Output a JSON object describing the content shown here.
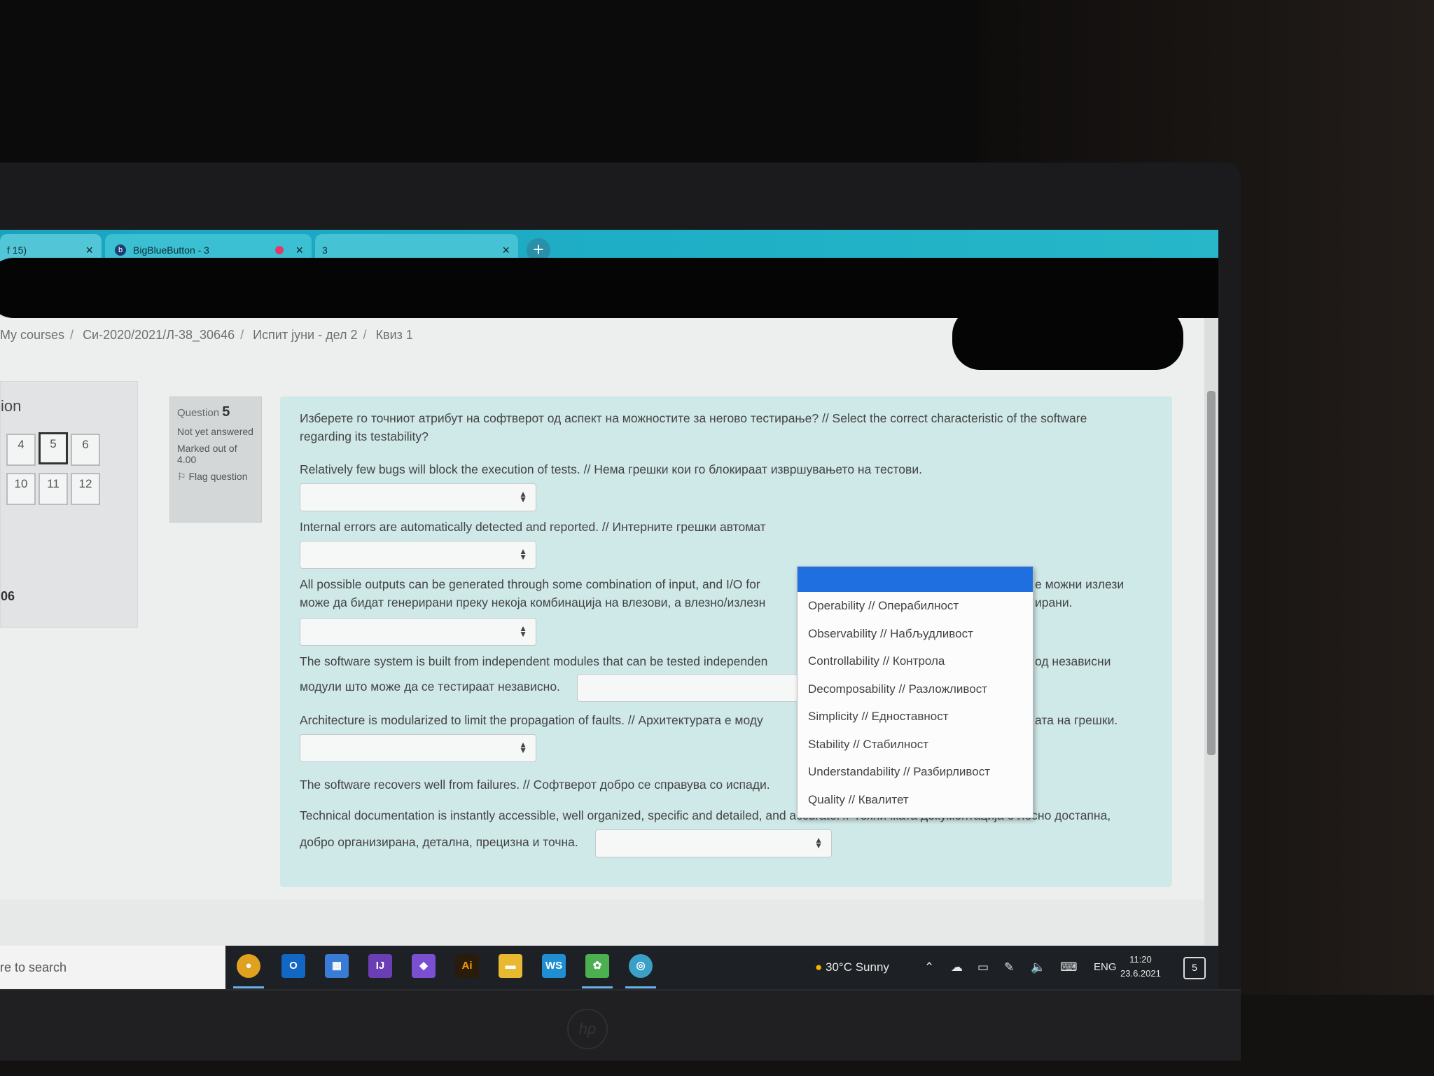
{
  "browser": {
    "tabs": [
      {
        "label": "f 15)",
        "close": "×"
      },
      {
        "label": "BigBlueButton - 3",
        "close": "×"
      },
      {
        "label": "3",
        "close": "×"
      }
    ],
    "new_tab": "+"
  },
  "breadcrumb": [
    "My courses",
    "Си-2020/2021/Л-38_30646",
    "Испит јуни - дел 2",
    "Квиз 1"
  ],
  "nav": {
    "title": "ion",
    "boxes": [
      "4",
      "5",
      "6",
      "10",
      "11",
      "12"
    ],
    "current": "5",
    "bottom_text": "06"
  },
  "question_info": {
    "label": "Question",
    "number": "5",
    "status": "Not yet answered",
    "marked": "Marked out of 4.00",
    "flag": "Flag question"
  },
  "question": {
    "prompt": "Изберете го точниот атрибут на софтверот од аспект на можностите за негово тестирање? // Select the correct characteristic of the software regarding its testability?",
    "statements": [
      "Relatively few bugs will block the execution of tests. // Нема грешки кои го блокираат извршувањето на тестови.",
      "Internal errors are automatically detected and reported. // Интерните грешки автомат",
      "All possible outputs can be generated through some combination of input, and I/O for",
      "може да бидат генерирани преку некоја комбинација на влезови, а влезно/излезн",
      "е можни излези",
      "ирани.",
      "The software system is built from independent modules that can be tested independen",
      "од независни",
      "модули што може да се тестираат независно.",
      "Architecture is modularized to limit the propagation of faults. // Архитектурата е моду",
      "ата на грешки.",
      "The software recovers well from failures. // Софтверот добро се справува со испади.",
      "Technical documentation is instantly accessible, well organized, specific and detailed, and accurate. // Техничката документација е лесно достапна,",
      "добро организирана, детална, прецизна и точна."
    ]
  },
  "dropdown": {
    "options": [
      "Operability // Операбилност",
      "Observability // Набљудливост",
      "Controllability // Контрола",
      "Decomposability // Разложливост",
      "Simplicity // Едноставност",
      "Stability // Стабилност",
      "Understandability // Разбирливост",
      "Quality // Квалитет"
    ]
  },
  "taskbar": {
    "search": "re to search",
    "weather": "30°C  Sunny",
    "lang": "ENG",
    "time": "11:20",
    "date": "23.6.2021",
    "notifications": "5"
  },
  "icons": [
    "chrome-icon",
    "outlook-icon",
    "calendar-icon",
    "intellij-icon",
    "visual-studio-icon",
    "illustrator-icon",
    "file-explorer-icon",
    "webstorm-icon",
    "app-icon",
    "chrome-canary-icon"
  ]
}
